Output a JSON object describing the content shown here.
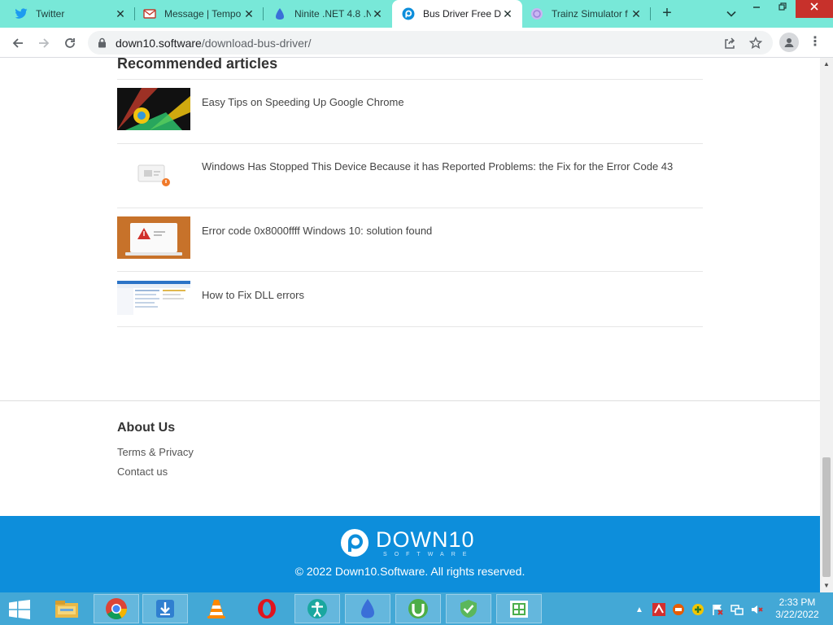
{
  "browser": {
    "tabs": [
      {
        "title": "Twitter",
        "icon": "twitter-icon"
      },
      {
        "title": "Message | Tempo",
        "icon": "mail-icon"
      },
      {
        "title": "Ninite .NET 4.8 .N",
        "icon": "ninite-icon"
      },
      {
        "title": "Bus Driver Free D",
        "icon": "down10-icon"
      },
      {
        "title": "Trainz Simulator f",
        "icon": "trainz-icon"
      }
    ],
    "new_tab": "+",
    "url_host": "down10.software",
    "url_path": "/download-bus-driver/"
  },
  "page": {
    "recommended_title": "Recommended articles",
    "articles": [
      {
        "title": "Easy Tips on Speeding Up Google Chrome"
      },
      {
        "title": "Windows Has Stopped This Device Because it has Reported Problems: the Fix for the Error Code 43"
      },
      {
        "title": "Error code 0x8000ffff Windows 10: solution found"
      },
      {
        "title": "How to Fix DLL errors"
      }
    ],
    "about": {
      "title": "About Us",
      "links": [
        "Terms & Privacy",
        "Contact us"
      ]
    },
    "footer": {
      "logo_main": "DOWN10",
      "logo_sub": "SOFTWARE",
      "copyright": "© 2022 Down10.Software. All rights reserved."
    }
  },
  "taskbar": {
    "apps": [
      "file-explorer-icon",
      "chrome-icon",
      "downloader-icon",
      "vlc-icon",
      "opera-icon",
      "accessibility-icon",
      "ninite-icon",
      "utorrent-icon",
      "security-check-icon",
      "store-icon"
    ],
    "time": "2:33 PM",
    "date": "3/22/2022"
  },
  "colors": {
    "tab_strip": "#78e8d8",
    "footer_blue": "#0d8edb",
    "taskbar": "#43a8d6"
  }
}
